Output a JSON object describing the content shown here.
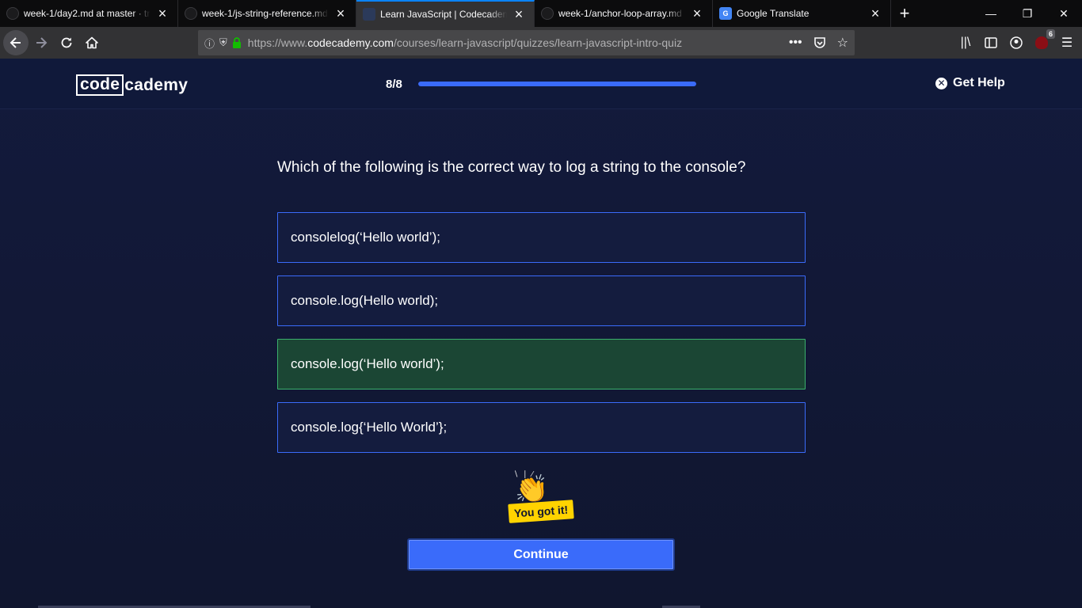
{
  "browser": {
    "tabs": [
      {
        "title": "week-1/day2.md at master · tri",
        "icon": "github-icon",
        "active": false
      },
      {
        "title": "week-1/js-string-reference.md",
        "icon": "github-icon",
        "active": false
      },
      {
        "title": "Learn JavaScript | Codecademy",
        "icon": "codecademy-icon",
        "active": true
      },
      {
        "title": "week-1/anchor-loop-array.md",
        "icon": "github-icon",
        "active": false
      },
      {
        "title": "Google Translate",
        "icon": "google-translate-icon",
        "active": false
      }
    ],
    "url_prefix": "https://www.",
    "url_domain": "codecademy.com",
    "url_path": "/courses/learn-javascript/quizzes/learn-javascript-intro-quiz",
    "extension_badge": "6"
  },
  "header": {
    "logo_box": "code",
    "logo_rest": "cademy",
    "progress_label": "8/8",
    "progress_fraction": 1.0,
    "get_help": "Get Help"
  },
  "quiz": {
    "question": "Which of the following is the correct way to log a string to the console?",
    "options": [
      {
        "text": "consolelog(‘Hello world’);",
        "state": "default"
      },
      {
        "text": "console.log(Hello world);",
        "state": "default"
      },
      {
        "text": "console.log(‘Hello world’);",
        "state": "correct"
      },
      {
        "text": "console.log{‘Hello World’};",
        "state": "default"
      }
    ],
    "feedback": "You got it!",
    "continue_label": "Continue"
  },
  "colors": {
    "accent": "#3a6bfa",
    "correct_bg": "#1b4634",
    "correct_border": "#3bb06d",
    "page_bg": "#10162f",
    "badge": "#ffd300"
  }
}
